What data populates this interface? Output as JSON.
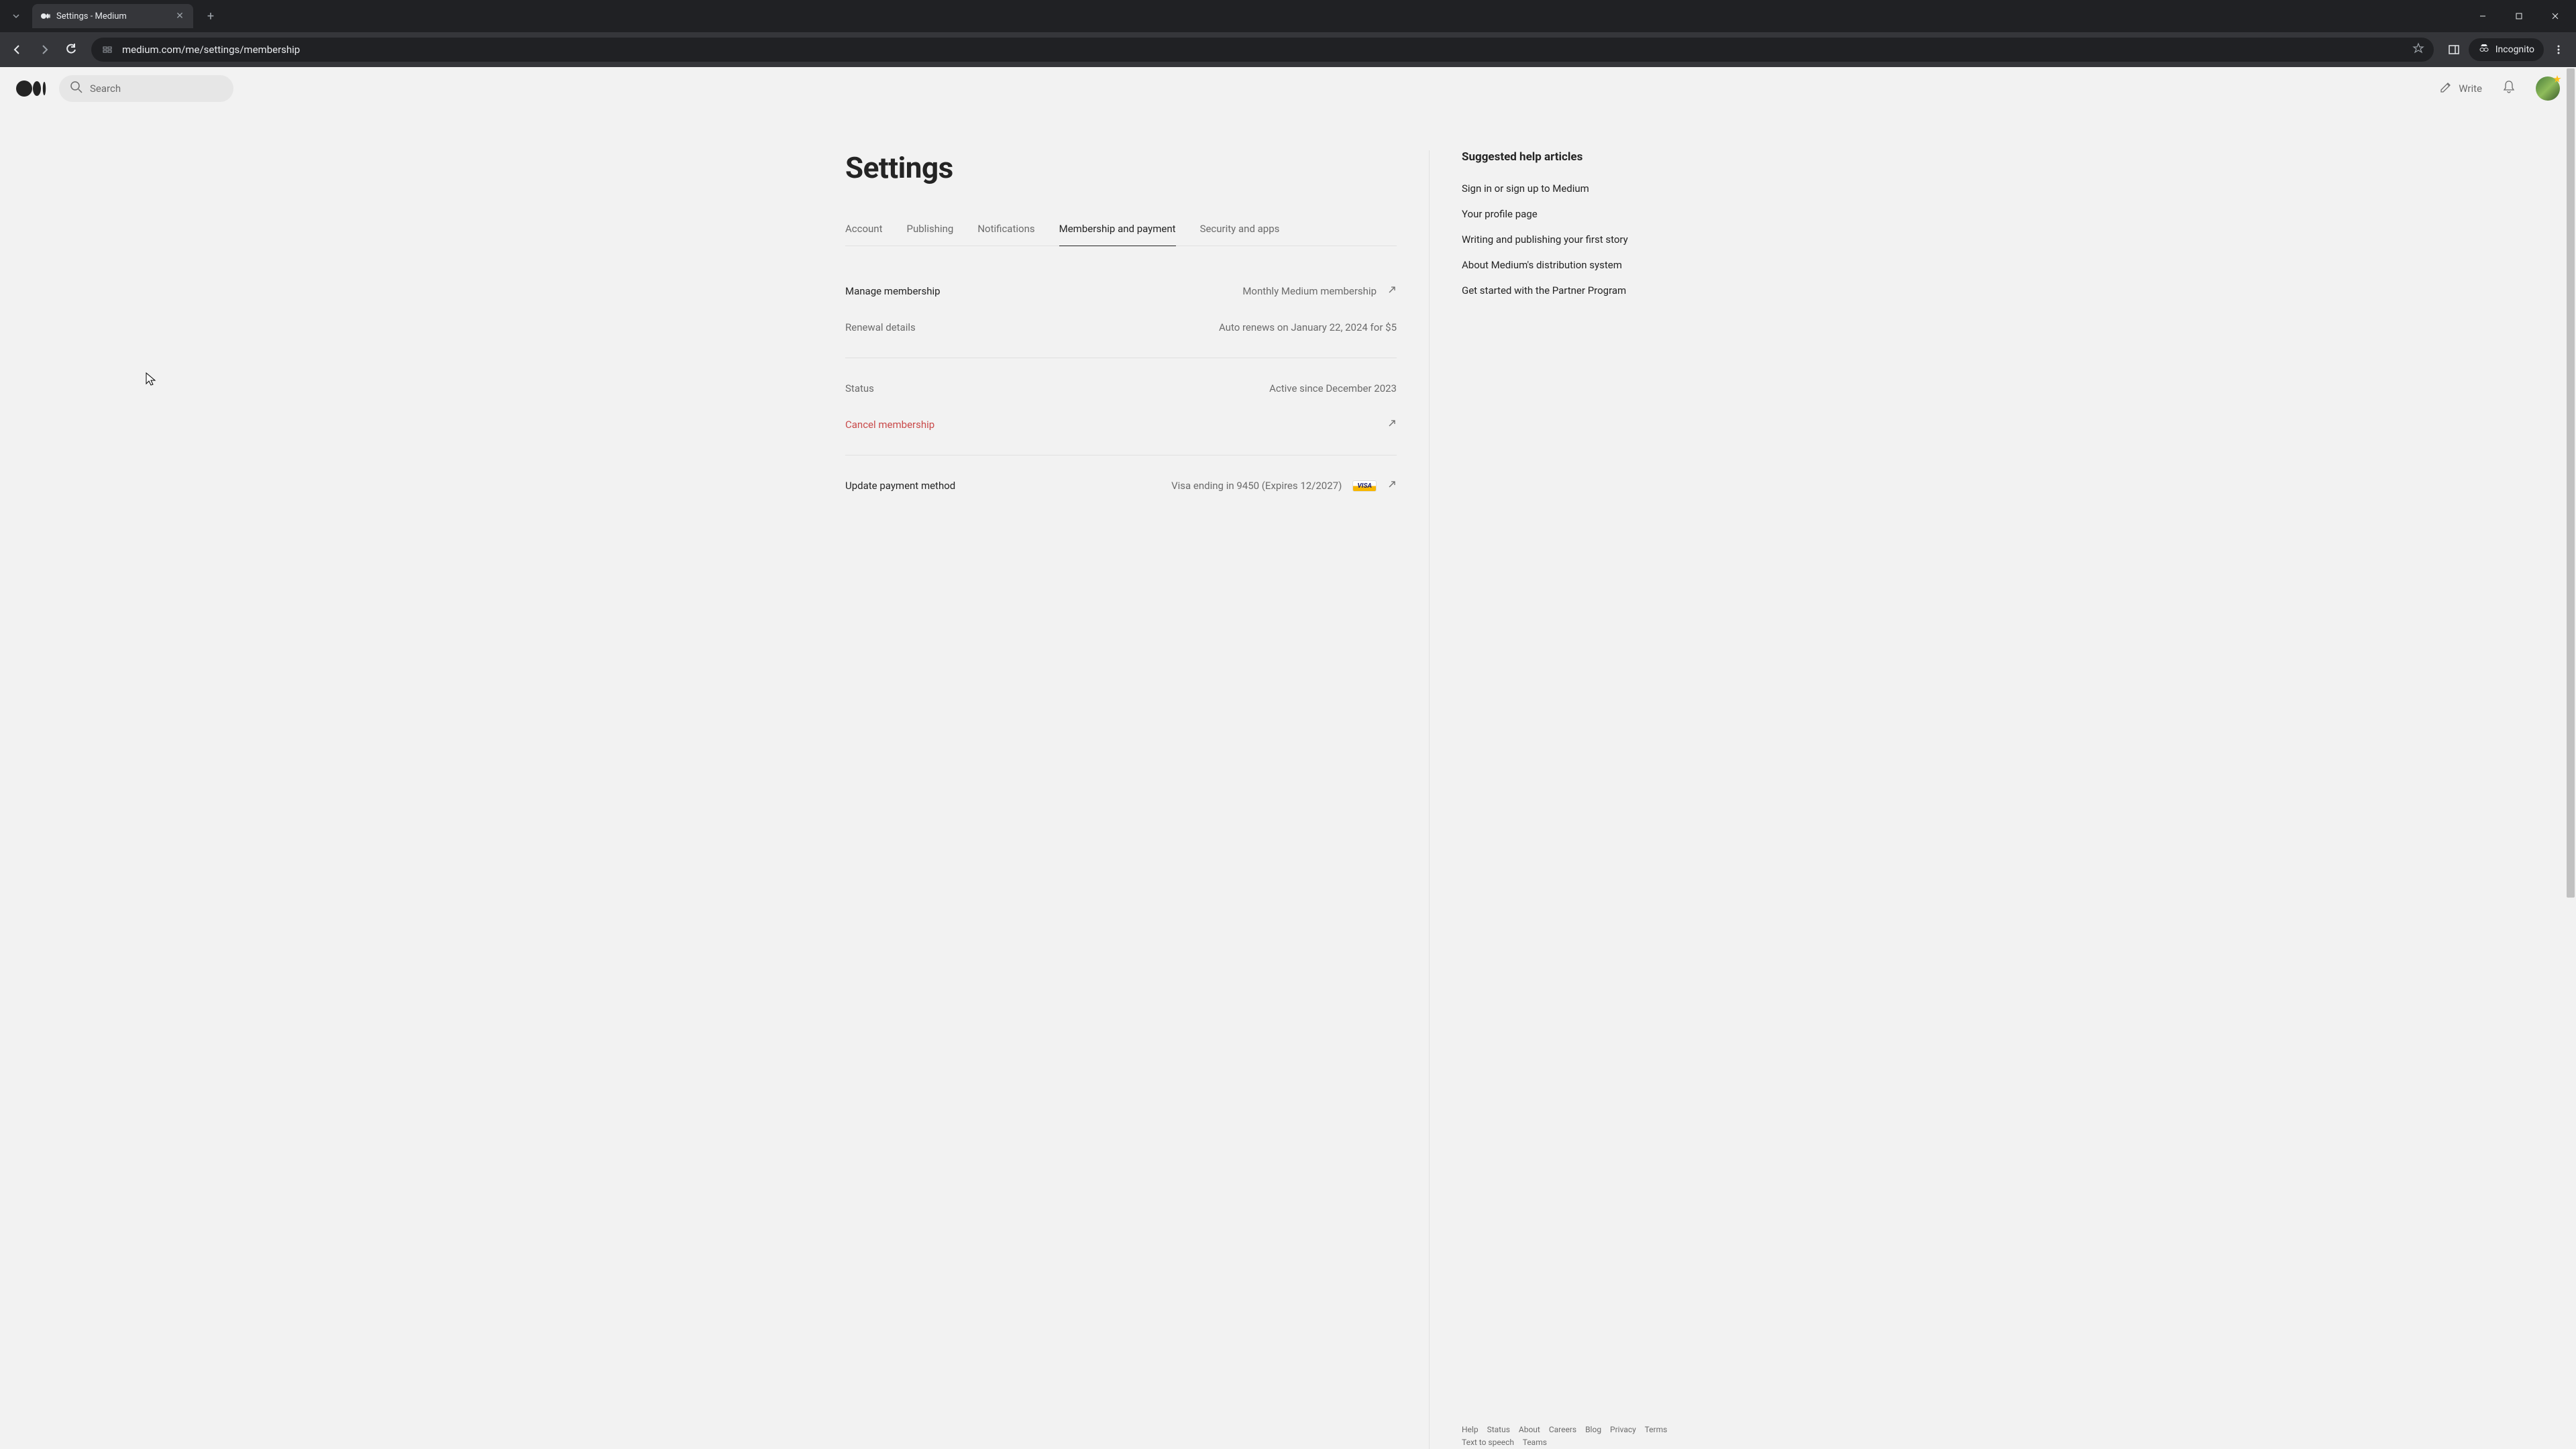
{
  "browser": {
    "tab_title": "Settings - Medium",
    "url": "medium.com/me/settings/membership",
    "incognito_label": "Incognito"
  },
  "header": {
    "search_placeholder": "Search",
    "write_label": "Write"
  },
  "page": {
    "title": "Settings",
    "tabs": [
      "Account",
      "Publishing",
      "Notifications",
      "Membership and payment",
      "Security and apps"
    ],
    "active_tab_index": 3
  },
  "membership": {
    "manage_label": "Manage membership",
    "manage_value": "Monthly Medium membership",
    "renewal_label": "Renewal details",
    "renewal_value": "Auto renews on January 22, 2024 for $5",
    "status_label": "Status",
    "status_value": "Active since December 2023",
    "cancel_label": "Cancel membership",
    "payment_label": "Update payment method",
    "payment_value": "Visa ending in 9450 (Expires 12/2027)",
    "visa_badge": "VISA"
  },
  "sidebar": {
    "title": "Suggested help articles",
    "links": [
      "Sign in or sign up to Medium",
      "Your profile page",
      "Writing and publishing your first story",
      "About Medium's distribution system",
      "Get started with the Partner Program"
    ]
  },
  "footer": {
    "row1": [
      "Help",
      "Status",
      "About",
      "Careers",
      "Blog",
      "Privacy",
      "Terms"
    ],
    "row2": [
      "Text to speech",
      "Teams"
    ]
  }
}
